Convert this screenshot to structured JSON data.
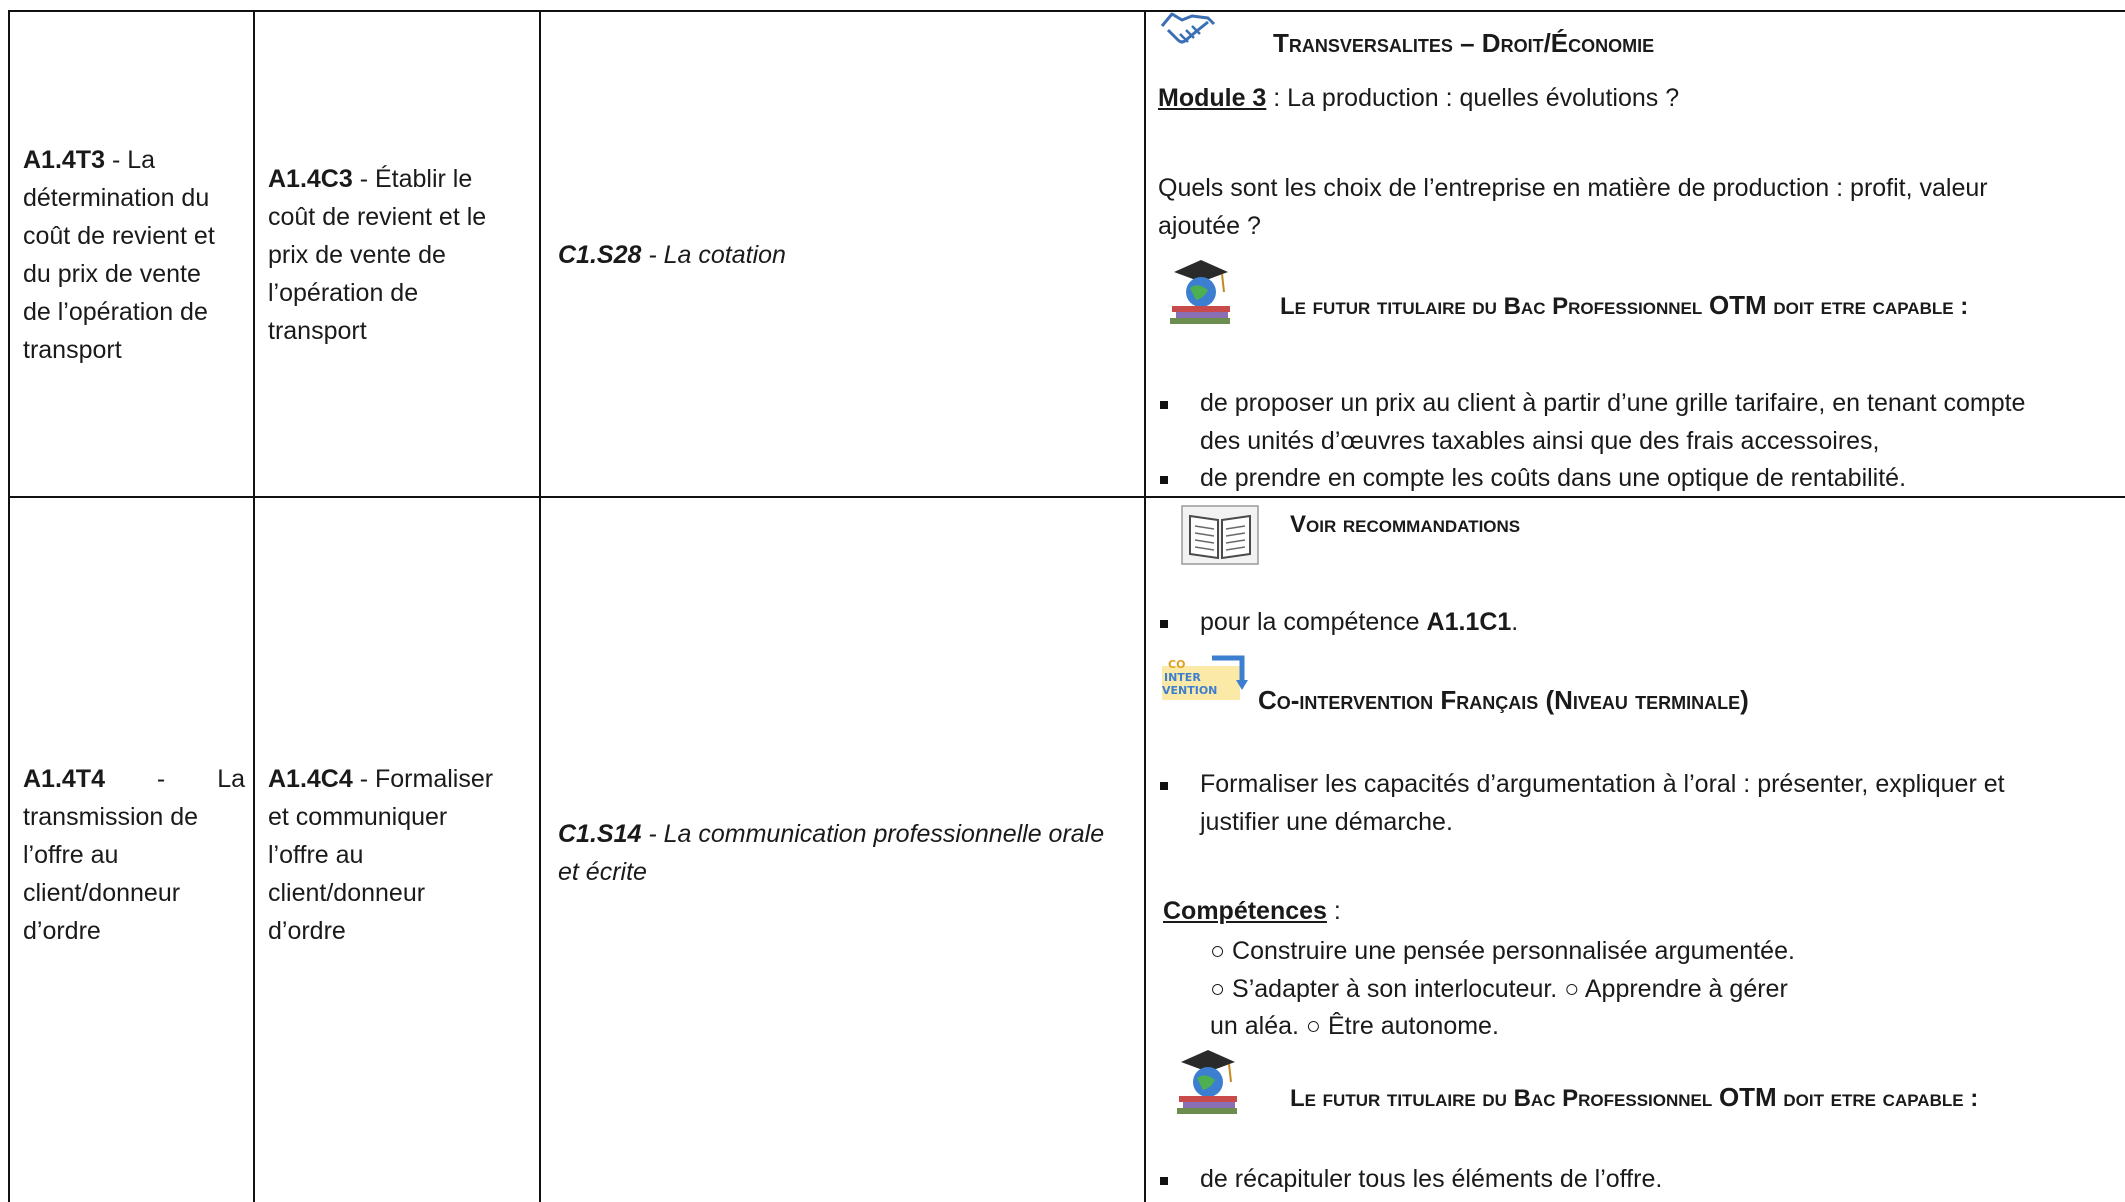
{
  "rows": [
    {
      "col1": {
        "code": "A1.4T3",
        "text_lines": [
          "- La",
          "détermination du",
          "coût de revient et",
          "du prix de vente",
          "de l’opération de",
          "transport"
        ]
      },
      "col2": {
        "code": "A1.4C3",
        "text_lines": [
          "- Établir le",
          "coût de revient et le",
          "prix de vente de",
          "l’opération de",
          "transport"
        ]
      },
      "col3": {
        "code": "C1.S28",
        "text": "- La cotation"
      },
      "col4": {
        "heading1": "Transversalites – Droit/Économie",
        "module_label": "Module 3",
        "module_text": " : La production : quelles évolutions ?",
        "question_line1": "Quels sont les choix de l’entreprise en matière de production : profit, valeur",
        "question_line2": "ajoutée ?",
        "heading2_pre": "Le futur titulaire du Bac Professionnel ",
        "heading2_otm": "OTM",
        "heading2_post": " doit etre capable :",
        "bullets": [
          [
            "de proposer un prix au client à partir d’une grille tarifaire, en tenant compte",
            "des unités d’œuvres taxables ainsi que des frais accessoires,"
          ],
          [
            "de prendre en compte les coûts dans une optique de rentabilité."
          ]
        ]
      }
    },
    {
      "col1": {
        "code": "A1.4T4",
        "dash": "-",
        "la": "La",
        "text_lines": [
          "transmission de",
          "l’offre au",
          "client/donneur",
          "d’ordre"
        ]
      },
      "col2": {
        "code": "A1.4C4",
        "text_lines": [
          "- Formaliser",
          "et communiquer",
          "l’offre au",
          "client/donneur",
          "d’ordre"
        ]
      },
      "col3": {
        "code": "C1.S14",
        "line1": "- La communication professionnelle orale",
        "line2": "et écrite"
      },
      "col4": {
        "heading_voir": "Voir recommandations",
        "bullet_voir_pre": "pour la compétence ",
        "bullet_voir_code": "A1.1C1",
        "bullet_voir_post": ".",
        "cointer_icon_text": [
          "CO",
          "INTER",
          "VENTION"
        ],
        "heading_cointer": "Co-intervention Français (Niveau terminale)",
        "bullet_cointer": [
          "Formaliser les capacités d’argumentation à l’oral : présenter, expliquer et",
          "justifier une démarche."
        ],
        "competences_label": "Compétences",
        "competences_colon": " :",
        "comp_line1": "○  Construire une pensée personnalisée argumentée.",
        "comp_line2": "○  S’adapter à son interlocuteur. ○ Apprendre à gérer",
        "comp_line3": "un aléa. ○ Être autonome.",
        "heading2_pre": "Le futur titulaire du Bac Professionnel ",
        "heading2_otm": "OTM",
        "heading2_post": " doit etre capable :",
        "bullet_final": "de récapituler tous les éléments de l’offre."
      }
    }
  ],
  "icons": [
    "handshake-icon",
    "graduate-globe-icon",
    "open-book-icon",
    "co-intervention-icon"
  ]
}
